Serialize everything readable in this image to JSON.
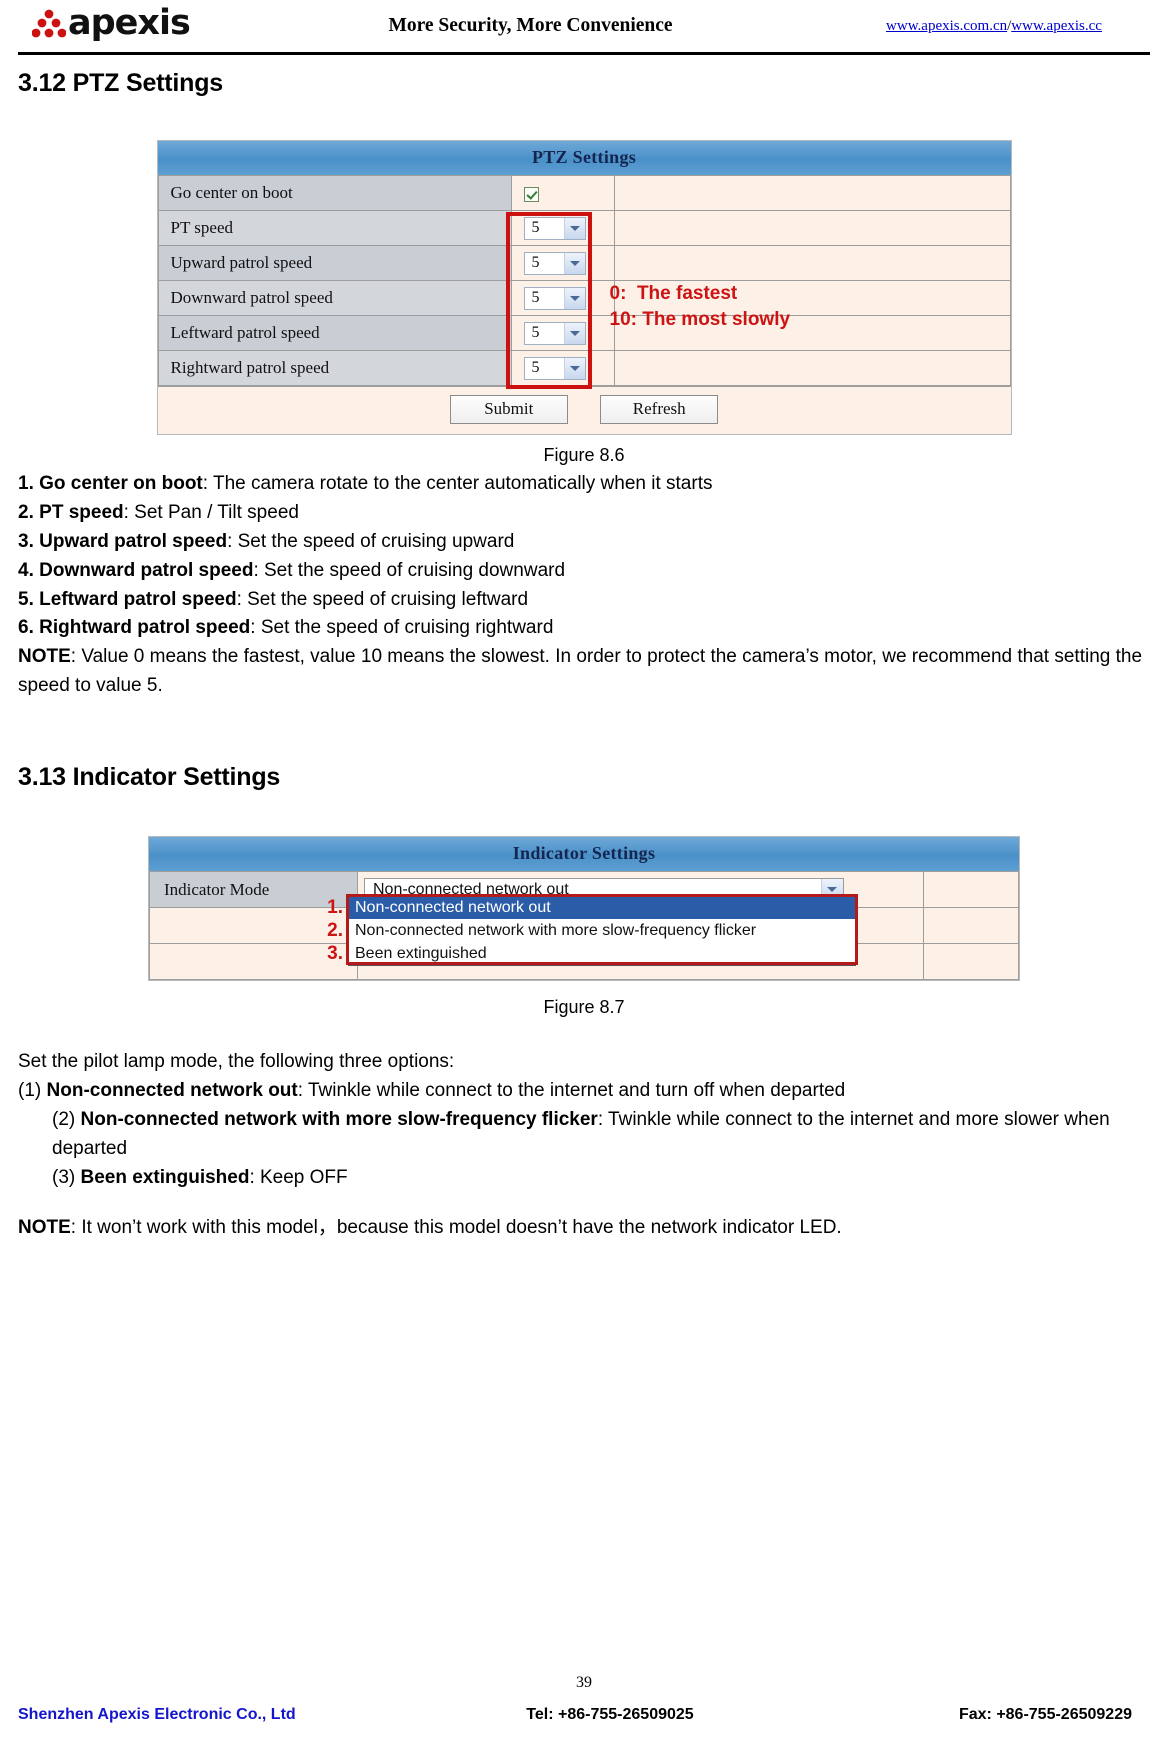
{
  "header": {
    "brand": "apexis",
    "slogan": "More Security, More Convenience",
    "link1": "www.apexis.com.cn",
    "separator": "/",
    "link2": "www.apexis.cc"
  },
  "sections": {
    "ptz": {
      "heading": "3.12 PTZ Settings",
      "figure_caption": "Figure 8.6",
      "panel": {
        "title": "PTZ Settings",
        "rows": [
          {
            "label": "Go center on boot",
            "control": "checkbox",
            "value": "checked"
          },
          {
            "label": "PT speed",
            "control": "select",
            "value": "5"
          },
          {
            "label": "Upward patrol speed",
            "control": "select",
            "value": "5"
          },
          {
            "label": "Downward patrol speed",
            "control": "select",
            "value": "5"
          },
          {
            "label": "Leftward patrol speed",
            "control": "select",
            "value": "5"
          },
          {
            "label": "Rightward patrol speed",
            "control": "select",
            "value": "5"
          }
        ],
        "legend_line1": "0:  The fastest",
        "legend_line2": "10: The most slowly",
        "submit_label": "Submit",
        "refresh_label": "Refresh"
      },
      "descriptions": [
        {
          "num": "1.",
          "term": "Go center on boot",
          "text": ": The camera rotate to the center automatically when it starts"
        },
        {
          "num": "2.",
          "term": "PT speed",
          "text": ": Set Pan / Tilt speed"
        },
        {
          "num": "3.",
          "term": "Upward patrol speed",
          "text": ": Set the speed of cruising upward"
        },
        {
          "num": "4.",
          "term": "Downward patrol speed",
          "text": ": Set the speed of cruising downward"
        },
        {
          "num": "5.",
          "term": "Leftward patrol speed",
          "text": ": Set the speed of cruising leftward"
        },
        {
          "num": "6.",
          "term": "Rightward patrol speed",
          "text": ": Set the speed of cruising rightward"
        }
      ],
      "note_label": "NOTE",
      "note_text": ": Value 0 means the fastest, value 10 means the slowest. In order to protect the camera’s motor, we recommend that setting the speed to value 5."
    },
    "indicator": {
      "heading": "3.13 Indicator Settings",
      "figure_caption": "Figure 8.7",
      "panel": {
        "title": "Indicator Settings",
        "row_label": "Indicator Mode",
        "selected_value": "Non-connected network out",
        "options": [
          {
            "num": "1.",
            "label": "Non-connected network out",
            "selected": true
          },
          {
            "num": "2.",
            "label": "Non-connected network with more slow-frequency flicker",
            "selected": false
          },
          {
            "num": "3.",
            "label": "Been extinguished",
            "selected": false
          }
        ]
      },
      "intro": "Set the pilot lamp mode, the following three options:",
      "descriptions": [
        {
          "num": "(1)",
          "term": "Non-connected network out",
          "text": ": Twinkle while connect to the internet and turn off when departed"
        },
        {
          "num": "(2)",
          "term": "Non-connected network with more slow-frequency flicker",
          "text": ": Twinkle while connect to the internet and more slower when departed"
        },
        {
          "num": "(3)",
          "term": "Been extinguished",
          "text": ": Keep OFF"
        }
      ],
      "note_label": "NOTE",
      "note_text": ": It won’t work with this model，because this model doesn’t have the network indicator LED."
    }
  },
  "footer": {
    "page_number": "39",
    "company": "Shenzhen Apexis Electronic Co., Ltd",
    "tel": "Tel: +86-755-26509025",
    "fax": "Fax: +86-755-26509229"
  },
  "colors": {
    "panel_header_blue": "#4a90c9",
    "panel_body": "#fdf0e6",
    "row_label_gray": "#c9cdd4",
    "annotation_red": "#cc1414",
    "link_blue": "#0000cc",
    "footer_blue": "#1515cc",
    "option_selected_blue": "#2a5ca8"
  }
}
